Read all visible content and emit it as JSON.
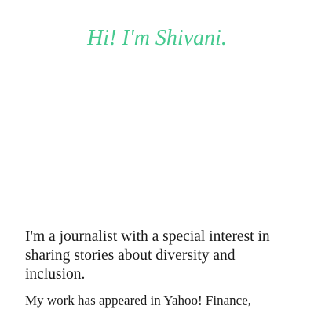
{
  "header": {
    "greeting": "Hi! I'm Shivani.",
    "accent_color": "#45c98f"
  },
  "intro": {
    "bio": "I'm a journalist with a special interest in sharing stories about diversity and inclusion.",
    "work": "My work has appeared in Yahoo! Finance,"
  }
}
